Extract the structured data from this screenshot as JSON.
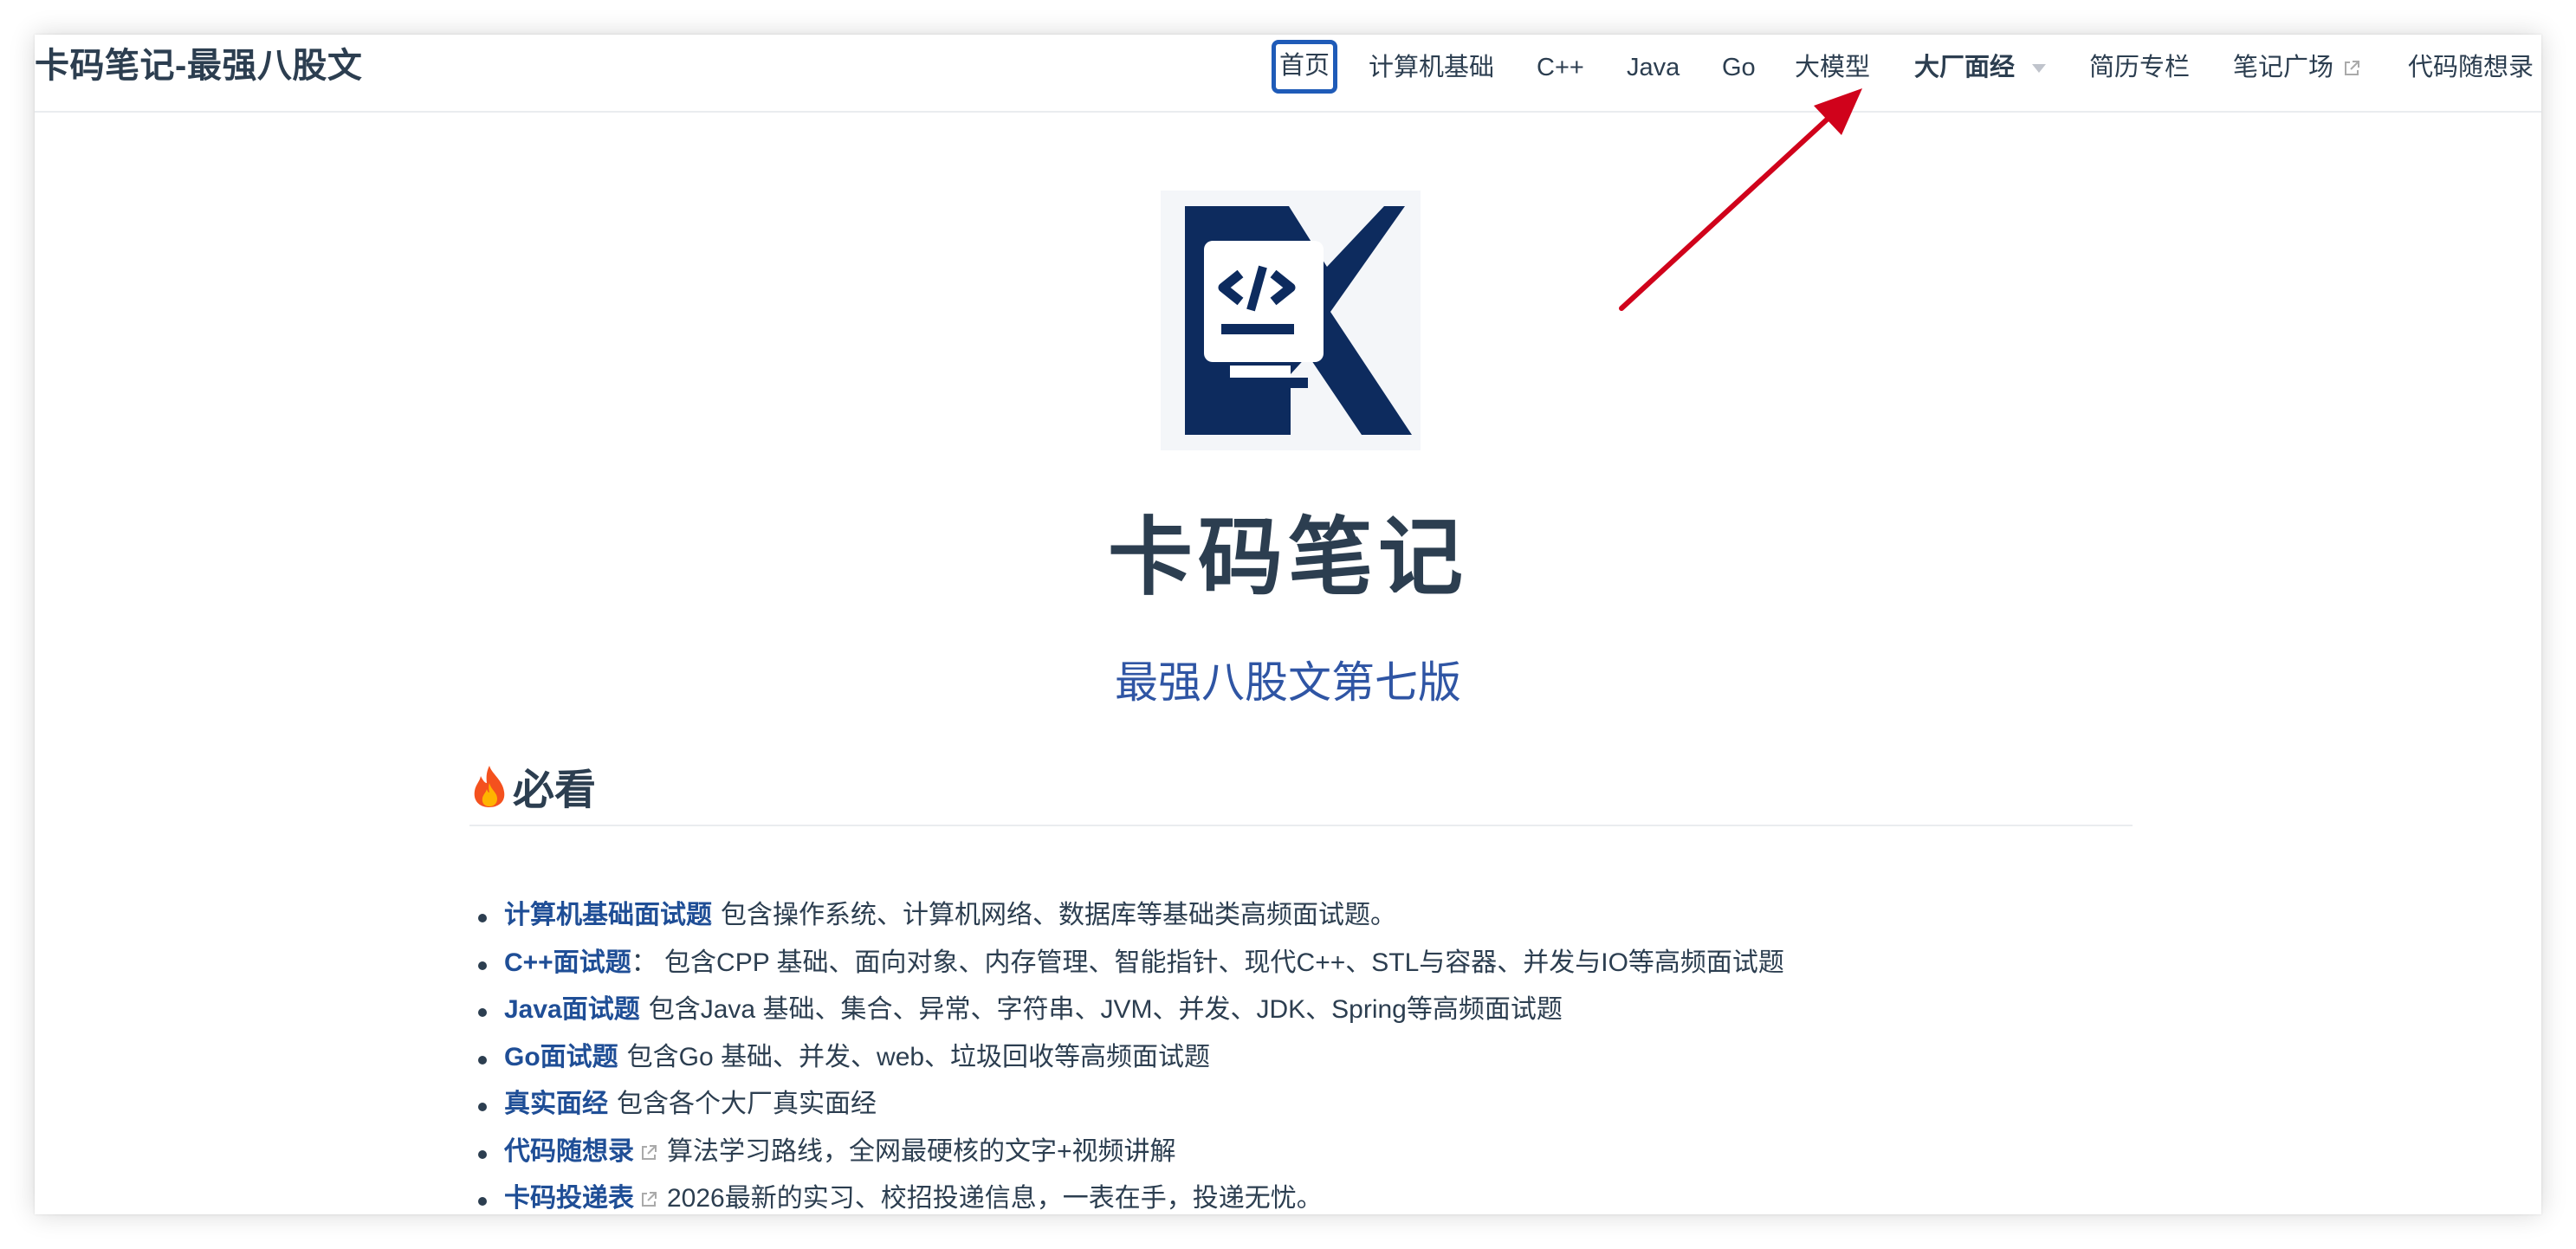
{
  "navbar": {
    "site_name": "卡码笔记-最强八股文",
    "items": [
      {
        "label": "首页"
      },
      {
        "label": "计算机基础"
      },
      {
        "label": "C++"
      },
      {
        "label": "Java"
      },
      {
        "label": "Go"
      },
      {
        "label": "大模型"
      },
      {
        "label": "大厂面经"
      },
      {
        "label": "简历专栏"
      },
      {
        "label": "笔记广场"
      },
      {
        "label": "代码随想录"
      }
    ]
  },
  "hero": {
    "title": "卡码笔记",
    "subtitle": "最强八股文第七版",
    "logo_letter": "K"
  },
  "section": {
    "heading": "必看",
    "heading_icon": "fire-icon",
    "items": [
      {
        "link": "计算机基础面试题",
        "desc": "包含操作系统、计算机网络、数据库等基础类高频面试题。"
      },
      {
        "link": "C++面试题",
        "desc": "： 包含CPP 基础、面向对象、内存管理、智能指针、现代C++、STL与容器、并发与IO等高频面试题"
      },
      {
        "link": "Java面试题",
        "desc": "包含Java 基础、集合、异常、字符串、JVM、并发、JDK、Spring等高频面试题"
      },
      {
        "link": "Go面试题",
        "desc": "包含Go 基础、并发、web、垃圾回收等高频面试题"
      },
      {
        "link": "真实面经",
        "desc": "包含各个大厂真实面经"
      },
      {
        "link": "代码随想录",
        "desc": "算法学习路线，全网最硬核的文字+视频讲解"
      },
      {
        "link": "卡码投递表",
        "desc": "2026最新的实习、校招投递信息，一表在手，投递无忧。"
      }
    ]
  },
  "colors": {
    "text": "#2c3e50",
    "link": "#1f4e96",
    "subtitle": "#2f55a4",
    "active_border": "#1f5bb8",
    "logo_navy": "#0d2b5e",
    "annotation_arrow": "#d0021b"
  }
}
